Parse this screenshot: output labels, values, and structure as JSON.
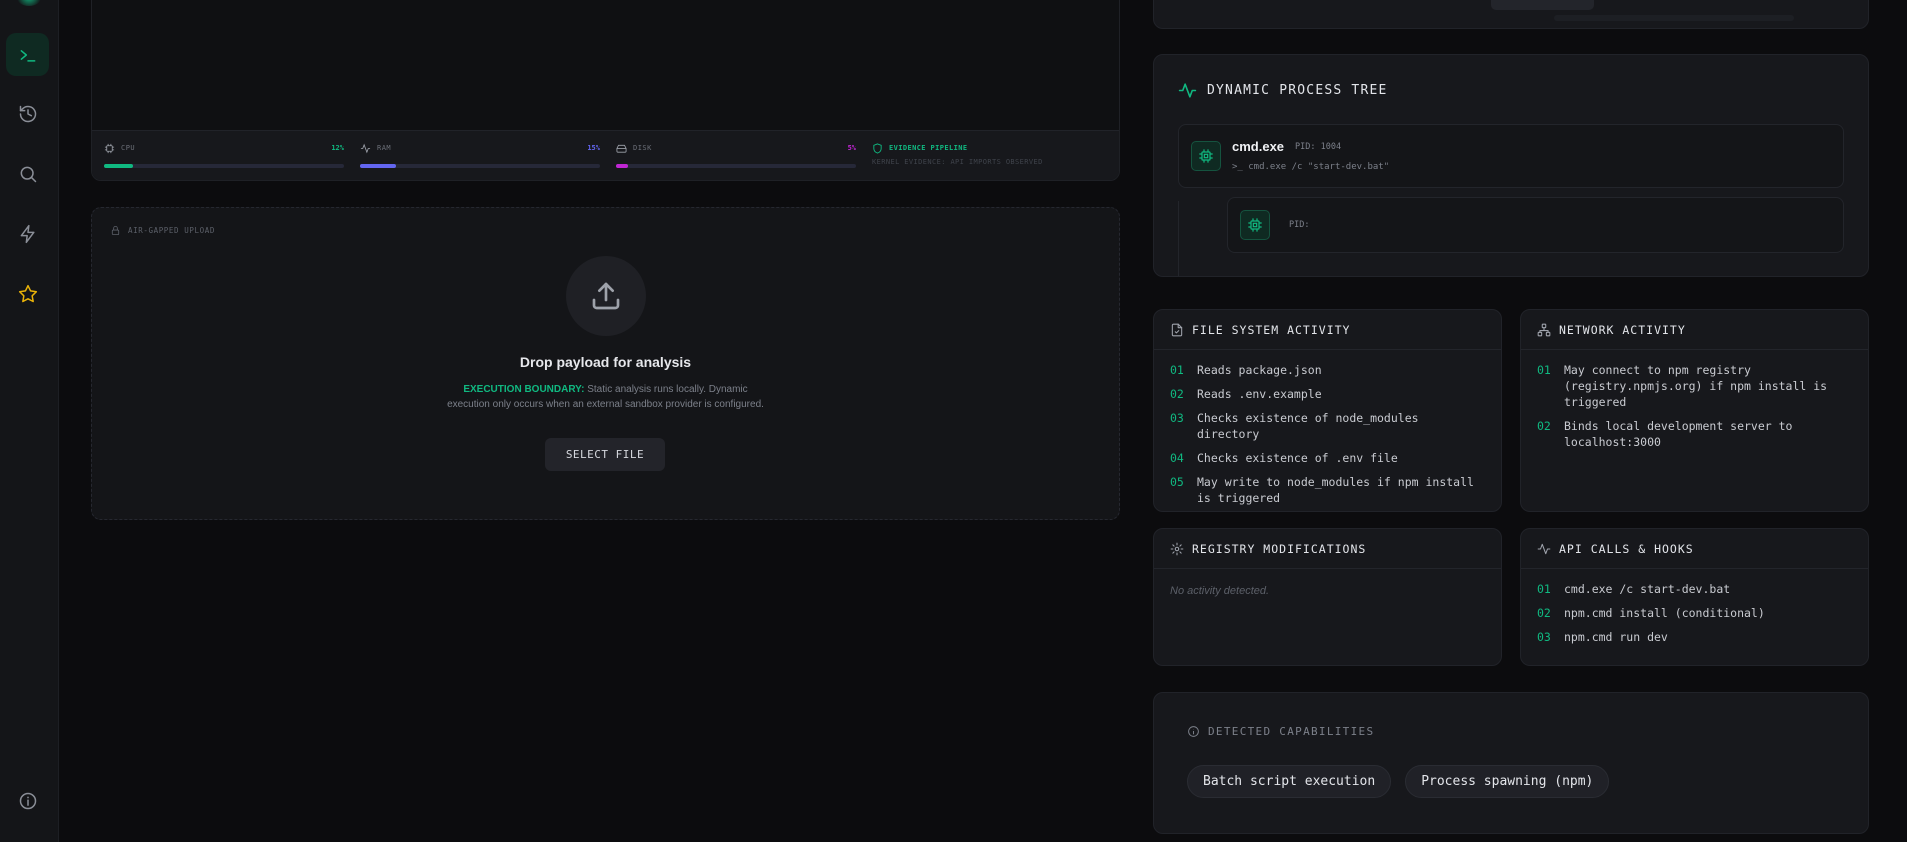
{
  "sidebar": {
    "items": [
      {
        "name": "terminal",
        "icon": "terminal-icon",
        "active": true
      },
      {
        "name": "history",
        "icon": "history-icon"
      },
      {
        "name": "search",
        "icon": "search-icon"
      },
      {
        "name": "flash",
        "icon": "lightning-icon"
      },
      {
        "name": "favorites",
        "icon": "star-icon"
      }
    ],
    "footer_icon": "info-icon"
  },
  "metrics": {
    "cpu": {
      "label": "CPU",
      "value": "12%",
      "fill": 0.12,
      "color": "#10b981"
    },
    "ram": {
      "label": "RAM",
      "value": "15%",
      "fill": 0.15,
      "color": "#6366f1"
    },
    "disk": {
      "label": "DISK",
      "value": "5%",
      "fill": 0.05,
      "color": "#c026d3"
    },
    "evidence": {
      "title": "EVIDENCE PIPELINE",
      "subtitle": "KERNEL EVIDENCE: API IMPORTS OBSERVED"
    }
  },
  "upload": {
    "label": "AIR-GAPPED UPLOAD",
    "title": "Drop payload for analysis",
    "boundary_label": "EXECUTION BOUNDARY:",
    "boundary_text_1": " Static analysis runs locally. Dynamic",
    "boundary_text_2": "execution only occurs when an external sandbox provider is configured.",
    "button": "SELECT FILE"
  },
  "process_tree": {
    "title": "DYNAMIC PROCESS TREE",
    "root": {
      "name": "cmd.exe",
      "pid": "PID: 1004",
      "command": ">_ cmd.exe /c \"start-dev.bat\""
    },
    "child": {
      "pid": "PID:"
    }
  },
  "file_system": {
    "title": "FILE SYSTEM ACTIVITY",
    "items": [
      {
        "n": "01",
        "text": "Reads package.json"
      },
      {
        "n": "02",
        "text": "Reads .env.example"
      },
      {
        "n": "03",
        "text": "Checks existence of node_modules directory"
      },
      {
        "n": "04",
        "text": "Checks existence of .env file"
      },
      {
        "n": "05",
        "text": "May write to node_modules if npm install is triggered"
      }
    ]
  },
  "network": {
    "title": "NETWORK ACTIVITY",
    "items": [
      {
        "n": "01",
        "text": "May connect to npm registry (registry.npmjs.org) if npm install is triggered"
      },
      {
        "n": "02",
        "text": "Binds local development server to localhost:3000"
      }
    ]
  },
  "registry": {
    "title": "REGISTRY MODIFICATIONS",
    "empty": "No activity detected."
  },
  "api_calls": {
    "title": "API CALLS & HOOKS",
    "items": [
      {
        "n": "01",
        "text": "cmd.exe /c start-dev.bat"
      },
      {
        "n": "02",
        "text": "npm.cmd install (conditional)"
      },
      {
        "n": "03",
        "text": "npm.cmd run dev"
      }
    ]
  },
  "capabilities": {
    "title": "DETECTED CAPABILITIES",
    "items": [
      "Batch script execution",
      "Process spawning (npm)"
    ]
  }
}
